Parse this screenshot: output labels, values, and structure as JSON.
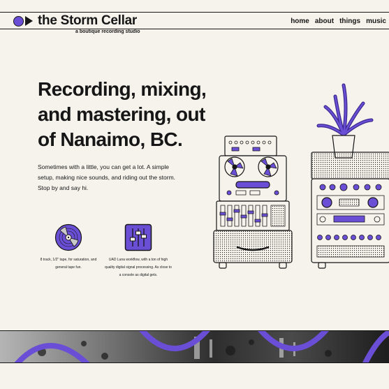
{
  "header": {
    "brand_name": "the Storm Cellar",
    "tagline": "a boutique recording studio",
    "nav": [
      {
        "label": "home"
      },
      {
        "label": "about"
      },
      {
        "label": "things"
      },
      {
        "label": "music"
      }
    ]
  },
  "hero": {
    "title": "Recording, mixing, and mastering, out of Nanaimo, BC.",
    "description": "Sometimes with a little, you can get a lot. A simple setup, making nice sounds, and riding out the storm. Stop by and say hi."
  },
  "features": [
    {
      "icon": "tape-reel-icon",
      "text": "8 track, 1/2\" tape, for saturation, and general tape fun."
    },
    {
      "icon": "mixer-faders-icon",
      "text": "UAD Luna workflow, with a ton of high quality digital signal processing. As close to a console as digital gets."
    }
  ],
  "colors": {
    "accent": "#6a4fd6",
    "background": "#f5f3ec",
    "ink": "#161616"
  }
}
